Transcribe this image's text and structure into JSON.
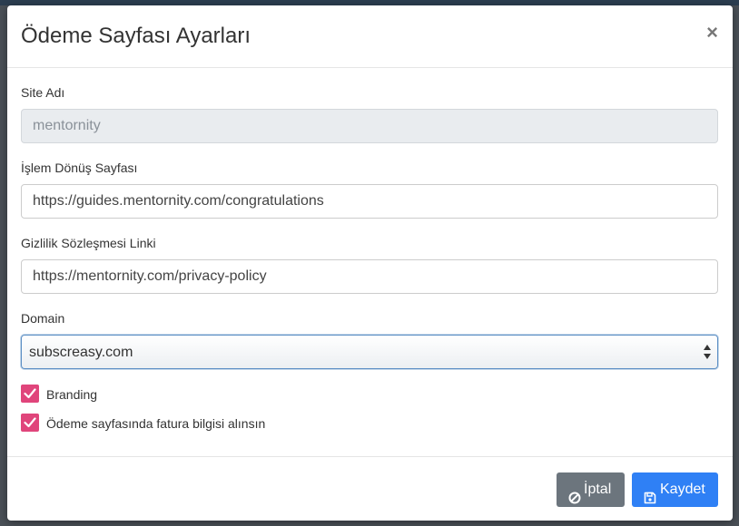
{
  "modal": {
    "title": "Ödeme Sayfası Ayarları",
    "close_symbol": "×"
  },
  "fields": {
    "site_name": {
      "label": "Site Adı",
      "value": "mentornity",
      "readonly": true
    },
    "return_page": {
      "label": "İşlem Dönüş Sayfası",
      "value": "https://guides.mentornity.com/congratulations"
    },
    "privacy_link": {
      "label": "Gizlilik Sözleşmesi Linki",
      "value": "https://mentornity.com/privacy-policy"
    },
    "domain": {
      "label": "Domain",
      "selected": "subscreasy.com"
    }
  },
  "checkboxes": {
    "branding": {
      "label": "Branding",
      "checked": true
    },
    "billing_info": {
      "label": "Ödeme sayfasında fatura bilgisi alınsın",
      "checked": true
    }
  },
  "footer": {
    "cancel_label": "İptal",
    "save_label": "Kaydet"
  },
  "colors": {
    "checkbox": "#e0457b",
    "save_button": "#2f80f5",
    "cancel_button": "#6c757d"
  },
  "icons": {
    "close": "close-icon",
    "cancel": "ban-icon",
    "save": "floppy-disk-icon",
    "select": "select-arrows-icon",
    "check": "checkmark-icon"
  }
}
